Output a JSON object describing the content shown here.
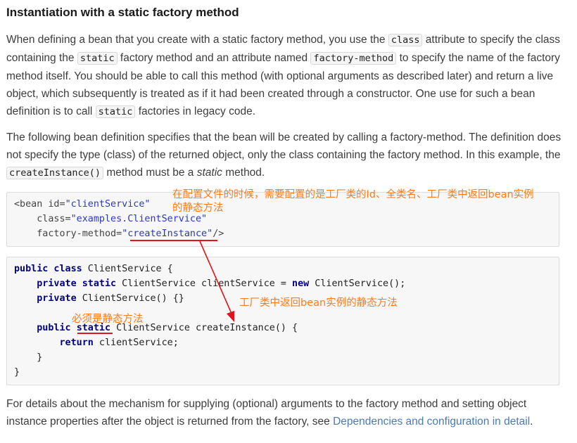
{
  "section_title": "Instantiation with a static factory method",
  "para1": {
    "t1": "When defining a bean that you create with a static factory method, you use the ",
    "c1": "class",
    "t2": " attribute to specify the class containing the ",
    "c2": "static",
    "t3": " factory method and an attribute named ",
    "c3": "factory-method",
    "t4": " to specify the name of the factory method itself. You should be able to call this method (with optional arguments as described later) and return a live object, which subsequently is treated as if it had been created through a constructor. One use for such a bean definition is to call ",
    "c4": "static",
    "t5": " factories in legacy code."
  },
  "para2": {
    "t1": "The following bean definition specifies that the bean will be created by calling a factory-method. The definition does not specify the type (class) of the returned object, only the class containing the factory method. In this example, the ",
    "c1": "createInstance()",
    "t2": " method must be a ",
    "em": "static",
    "t3": " method."
  },
  "xml_code": {
    "l1_tag": "<bean",
    "l1_attr": " id=",
    "l1_val": "\"clientService\"",
    "l2_attr": "class=",
    "l2_val": "\"examples.ClientService\"",
    "l3_attr": "factory-method=",
    "l3_val": "\"createInstance\"",
    "l3_end": "/>"
  },
  "java_code": {
    "l1_kw": "public class",
    "l1_rest": " ClientService {",
    "l2_kw1": "private static",
    "l2_mid": " ClientService clientService = ",
    "l2_kw2": "new",
    "l2_rest": " ClientService();",
    "l3_kw": "private",
    "l3_rest": " ClientService() {}",
    "l5_kw1": "public",
    "l5_kw2": "static",
    "l5_rest": " ClientService createInstance() {",
    "l6_kw": "return",
    "l6_rest": " clientService;",
    "l7": "}",
    "l8": "}"
  },
  "annotations": {
    "a1_line1": "在配置文件的时候，需要配置的是工厂类的Id、全类名、工厂类中返回bean实例",
    "a1_line2": "的静态方法",
    "a2": "工厂类中返回bean实例的静态方法",
    "a3": "必须是静态方法",
    "color": "#ff7a1a",
    "underline_color": "#e0141e"
  },
  "para3": {
    "t1": "For details about the mechanism for supplying (optional) arguments to the factory method and setting object instance properties after the object is returned from the factory, see ",
    "link": "Dependencies and configuration in detail",
    "t2": "."
  },
  "colors": {
    "link": "#4a7bb6",
    "keyword": "#000080",
    "string": "#2a3ab8"
  }
}
